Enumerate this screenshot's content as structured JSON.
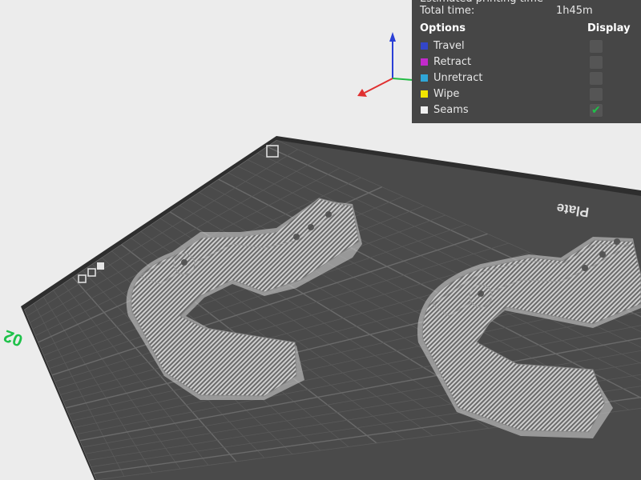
{
  "scene": {
    "bed_label": "Plate",
    "plate_number": "02",
    "icon_button_1": "plate-tools-icon",
    "icon_button_2": "plate-settings-icon",
    "icon_button_3": "plate-options-icon",
    "axis_icon": "axis-gizmo-icon",
    "colors": {
      "background": "#ececec",
      "bed": "#4a4a4a",
      "bed_edge": "#2e2e2e",
      "grid": "#5f5f5f",
      "plate_number": "#1fc24a",
      "axis_x": "#e03030",
      "axis_y": "#22bb44",
      "axis_z": "#2a3fd6"
    }
  },
  "legend": {
    "partial_top_line": "Estimated printing time",
    "total_time_label": "Total time:",
    "total_time_value": "1h45m",
    "options_header": "Options",
    "display_header": "Display",
    "items": [
      {
        "label": "Travel",
        "color": "#3346c8",
        "checked": false
      },
      {
        "label": "Retract",
        "color": "#c32acc",
        "checked": false
      },
      {
        "label": "Unretract",
        "color": "#2fa6d8",
        "checked": false
      },
      {
        "label": "Wipe",
        "color": "#f2e500",
        "checked": false
      },
      {
        "label": "Seams",
        "color": "#f0f0f0",
        "checked": true
      }
    ],
    "check_color": "#1fc24a"
  }
}
